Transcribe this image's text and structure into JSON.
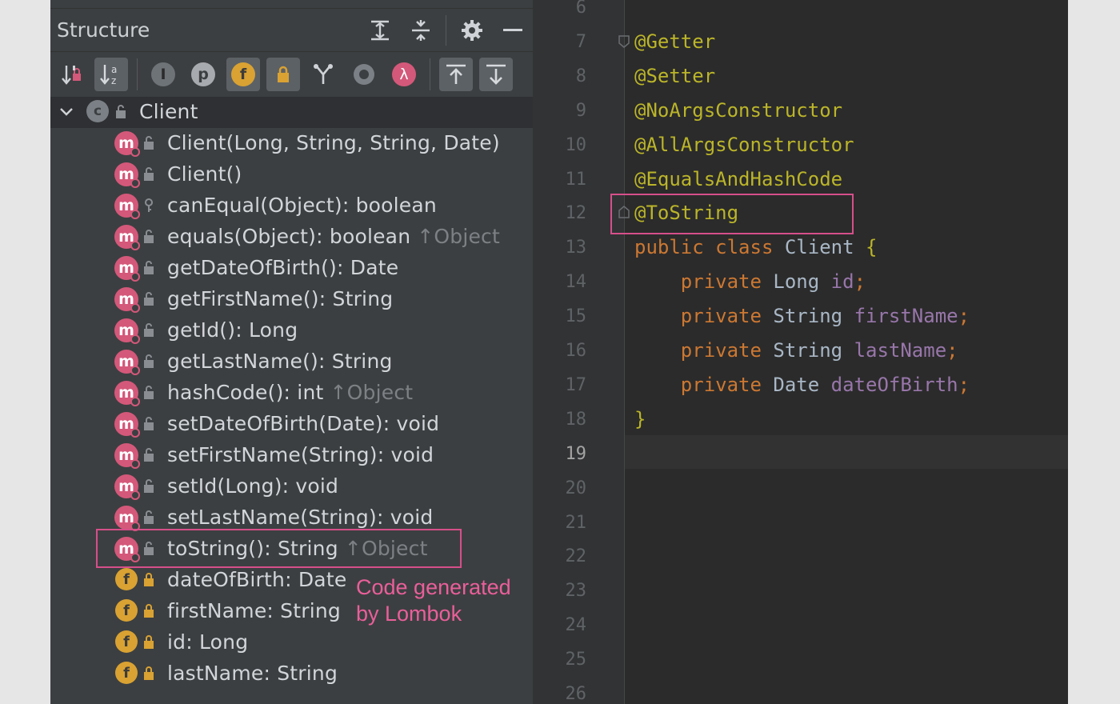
{
  "structure": {
    "title": "Structure",
    "toolbar": [
      {
        "icon": "sort-by-visibility-icon",
        "active": false
      },
      {
        "icon": "sort-alphabetically-icon",
        "active": true
      },
      {
        "icon": "show-inherited-icon",
        "label": "I"
      },
      {
        "icon": "show-properties-icon",
        "label": "p"
      },
      {
        "icon": "show-fields-icon",
        "label": "f",
        "active": true
      },
      {
        "icon": "show-non-public-icon",
        "active": true
      },
      {
        "icon": "show-merge-icon"
      },
      {
        "icon": "show-anonymous-icon"
      },
      {
        "icon": "show-lambdas-icon",
        "label": "λ"
      },
      {
        "icon": "autoscroll-to-source-icon"
      },
      {
        "icon": "autoscroll-from-source-icon"
      }
    ],
    "root": {
      "icon_label": "c",
      "name": "Client"
    },
    "method_icon_label": "m",
    "field_icon_label": "f",
    "members": [
      {
        "kind": "method",
        "text": "Client(Long, String, String, Date)",
        "inherited": ""
      },
      {
        "kind": "method",
        "text": "Client()",
        "inherited": ""
      },
      {
        "kind": "method",
        "text": "canEqual(Object): boolean",
        "inherited": "",
        "visibility": "protected"
      },
      {
        "kind": "method",
        "text": "equals(Object): boolean",
        "inherited": "↑Object"
      },
      {
        "kind": "method",
        "text": "getDateOfBirth(): Date",
        "inherited": ""
      },
      {
        "kind": "method",
        "text": "getFirstName(): String",
        "inherited": ""
      },
      {
        "kind": "method",
        "text": "getId(): Long",
        "inherited": ""
      },
      {
        "kind": "method",
        "text": "getLastName(): String",
        "inherited": ""
      },
      {
        "kind": "method",
        "text": "hashCode(): int",
        "inherited": "↑Object"
      },
      {
        "kind": "method",
        "text": "setDateOfBirth(Date): void",
        "inherited": ""
      },
      {
        "kind": "method",
        "text": "setFirstName(String): void",
        "inherited": ""
      },
      {
        "kind": "method",
        "text": "setId(Long): void",
        "inherited": ""
      },
      {
        "kind": "method",
        "text": "setLastName(String): void",
        "inherited": ""
      },
      {
        "kind": "method",
        "text": "toString(): String",
        "inherited": "↑Object"
      },
      {
        "kind": "field",
        "text": "dateOfBirth: Date",
        "inherited": ""
      },
      {
        "kind": "field",
        "text": "firstName: String",
        "inherited": ""
      },
      {
        "kind": "field",
        "text": "id: Long",
        "inherited": ""
      },
      {
        "kind": "field",
        "text": "lastName: String",
        "inherited": ""
      }
    ],
    "note": {
      "line1": "Code generated",
      "line2": "by Lombok"
    }
  },
  "editor": {
    "line_numbers": [
      "6",
      "7",
      "8",
      "9",
      "10",
      "11",
      "12",
      "13",
      "14",
      "15",
      "16",
      "17",
      "18",
      "19",
      "20",
      "21",
      "22",
      "23",
      "24",
      "25",
      "26"
    ],
    "current_line": "19",
    "lines": [
      "",
      "@Getter",
      "@Setter",
      "@NoArgsConstructor",
      "@AllArgsConstructor",
      "@EqualsAndHashCode",
      "@ToString",
      "public class Client {",
      "    private Long id;",
      "    private String firstName;",
      "    private String lastName;",
      "    private Date dateOfBirth;",
      "}",
      ""
    ]
  },
  "colors": {
    "highlight_box": "#d64f8a",
    "annotation": "#bbb529",
    "keyword": "#cc7832",
    "field": "#9876aa",
    "method_icon": "#d4587a",
    "field_icon": "#d9a232"
  }
}
